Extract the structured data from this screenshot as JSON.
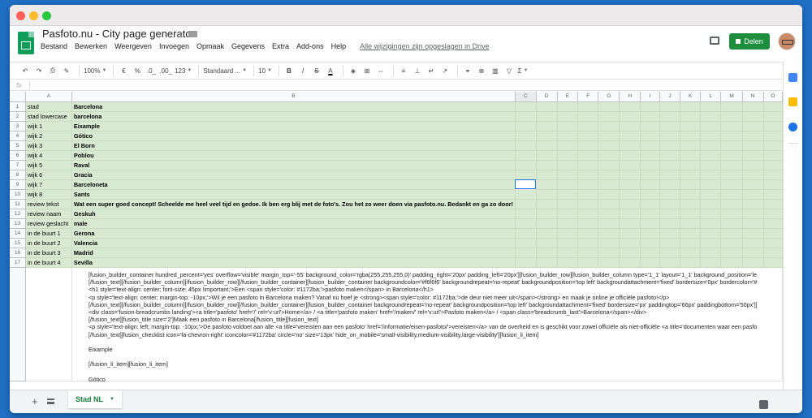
{
  "doc_title": "Pasfoto.nu - City page generator",
  "menu": [
    "Bestand",
    "Bewerken",
    "Weergeven",
    "Invoegen",
    "Opmaak",
    "Gegevens",
    "Extra",
    "Add-ons",
    "Help"
  ],
  "last_edit": "Alle wijzigingen zijn opgeslagen in Drive",
  "share_label": "Delen",
  "toolbar": {
    "zoom": "100%",
    "currency": "€",
    "percent": "%",
    "dec_decrease": ".0_",
    "dec_increase": ".00_",
    "more_formats": "123",
    "font": "Standaard ...",
    "font_size": "10",
    "bold": "B",
    "italic": "I",
    "strike": "S",
    "text_color": "A",
    "sigma": "Σ"
  },
  "formula_icon": "fx",
  "columns": [
    "A",
    "B",
    "C",
    "D",
    "E",
    "F",
    "G",
    "H",
    "I",
    "J",
    "K",
    "L",
    "M",
    "N",
    "O"
  ],
  "rows": [
    {
      "num": "1",
      "a": "stad",
      "b": "Barcelona"
    },
    {
      "num": "2",
      "a": "stad lowercase",
      "b": "barcelona"
    },
    {
      "num": "3",
      "a": "wijk 1",
      "b": "Eixample"
    },
    {
      "num": "4",
      "a": "wijk 2",
      "b": "Gótico"
    },
    {
      "num": "5",
      "a": "wijk 3",
      "b": "El Born"
    },
    {
      "num": "6",
      "a": "wijk 4",
      "b": "Poblou"
    },
    {
      "num": "7",
      "a": "wijk 5",
      "b": "Raval"
    },
    {
      "num": "8",
      "a": "wijk 6",
      "b": "Gracia"
    },
    {
      "num": "9",
      "a": "wijk 7",
      "b": "Barceloneta"
    },
    {
      "num": "10",
      "a": "wijk 8",
      "b": "Sants"
    },
    {
      "num": "11",
      "a": "review tekst",
      "b": "Wat een super goed concept! Scheelde me heel veel tijd en gedoe. Ik ben erg blij met de foto's. Zou het zo weer doen via pasfoto.nu. Bedankt en ga zo door!"
    },
    {
      "num": "12",
      "a": "review naam",
      "b": "Geskuh"
    },
    {
      "num": "13",
      "a": "review geslacht",
      "b": "male"
    },
    {
      "num": "14",
      "a": "in de buurt 1",
      "b": "Gerona"
    },
    {
      "num": "15",
      "a": "in de buurt 2",
      "b": "Valencia"
    },
    {
      "num": "16",
      "a": "in de buurt 3",
      "b": "Madrid"
    },
    {
      "num": "17",
      "a": "in de buurt 4",
      "b": "Sevilla"
    }
  ],
  "long_text": [
    "[fusion_builder_container hundred_percent='yes' overflow='visible' margin_top='-55' background_color='rgba(255,255,255,0)' padding_right='20px' padding_left='20px'][fusion_builder_row][fusion_builder_column type='1_1' layout='1_1' background_position='le",
    "[/fusion_text][/fusion_builder_column][/fusion_builder_row][/fusion_builder_container][fusion_builder_container backgroundcolor='#f6f6f6' backgroundrepeat='no-repeat' backgroundposition='top left' backgroundattachment='fixed' bordersize='0px' bordercolor='#",
    "<h1 style='text-align: center; font-size: 45px !important;'>Een <span style='color: #1172ba;'>pasfoto maken</span> in Barcelona</h1>",
    "<p style='text-align: center; margin-top: -10px;'>Wil je een pasfoto in Barcelona maken? Vanaf nu hoef je <strong><span style='color: #1172ba;'>de deur niet meer uit</span></strong> en maak je online je officiële pasfoto!</p>",
    "[/fusion_text][/fusion_builder_column][/fusion_builder_row][/fusion_builder_container][fusion_builder_container backgroundrepeat='no-repeat' backgroundposition='top left' backgroundattachment='fixed' bordersize='px' paddingtop='66px' paddingbottom='50px'][",
    "<div class='fusion-breadcrumbs landing'><a title='pasfoto' href='/' rel='v:url'>Home</a> / <a title='pasfoto maken' href='/maken/' rel='v:url'>Pasfoto maken</a> / <span class='breadcrumb_last'>Barcelona</span></div>",
    "[/fusion_text][fusion_title size='2']Maak een pasfoto in Barcelona[/fusion_title][fusion_text]",
    "<p style='text-align: left; margin-top: -10px;'>De pasfoto voldoet aan alle <a title='vereisten aan een pasfoto' href='/informatie/eisen-pasfoto/'>vereisten</a> van de overheid en is geschikt voor zowel officiële als niet-officiële <a title='documenten waar een pasfo",
    "[/fusion_text][fusion_checklist icon='fa-chevron-right' iconcolor='#1172ba' circle='no' size='13px' hide_on_mobile='small-visibility,medium-visibility,large-visibility'][fusion_li_item]",
    "",
    "Eixample",
    "",
    "[/fusion_li_item][fusion_li_item]",
    "",
    "Gótico"
  ],
  "sheet_tab": "Stad NL",
  "colors": {
    "fill": "#d9ead3",
    "accent": "#1e8e3e",
    "selection": "#1a73e8"
  }
}
